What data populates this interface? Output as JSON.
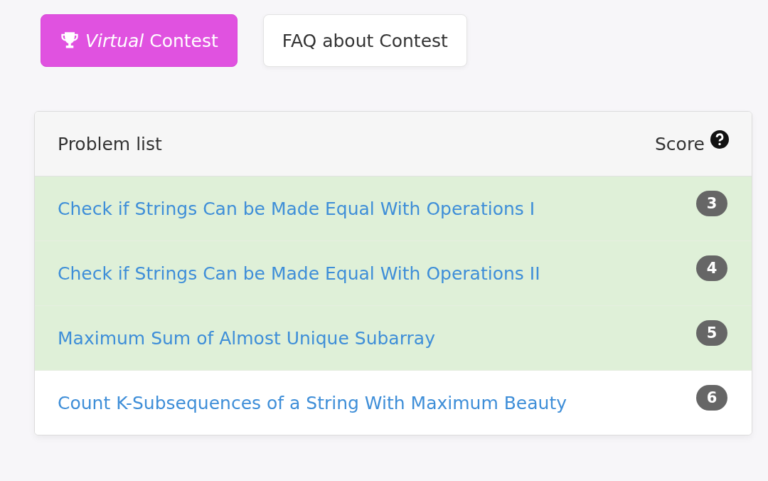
{
  "actions": [
    {
      "kind": "primary",
      "label_italic": "Virtual",
      "label": "Contest"
    },
    {
      "kind": "plain",
      "label": "FAQ about Contest"
    }
  ],
  "panel": {
    "title": "Problem list",
    "score_label": "Score"
  },
  "problems": [
    {
      "title": "Check if Strings Can be Made Equal With Operations I",
      "score": "3",
      "solved": true
    },
    {
      "title": "Check if Strings Can be Made Equal With Operations II",
      "score": "4",
      "solved": true
    },
    {
      "title": "Maximum Sum of Almost Unique Subarray",
      "score": "5",
      "solved": true
    },
    {
      "title": "Count K-Subsequences of a String With Maximum Beauty",
      "score": "6",
      "solved": false
    }
  ]
}
